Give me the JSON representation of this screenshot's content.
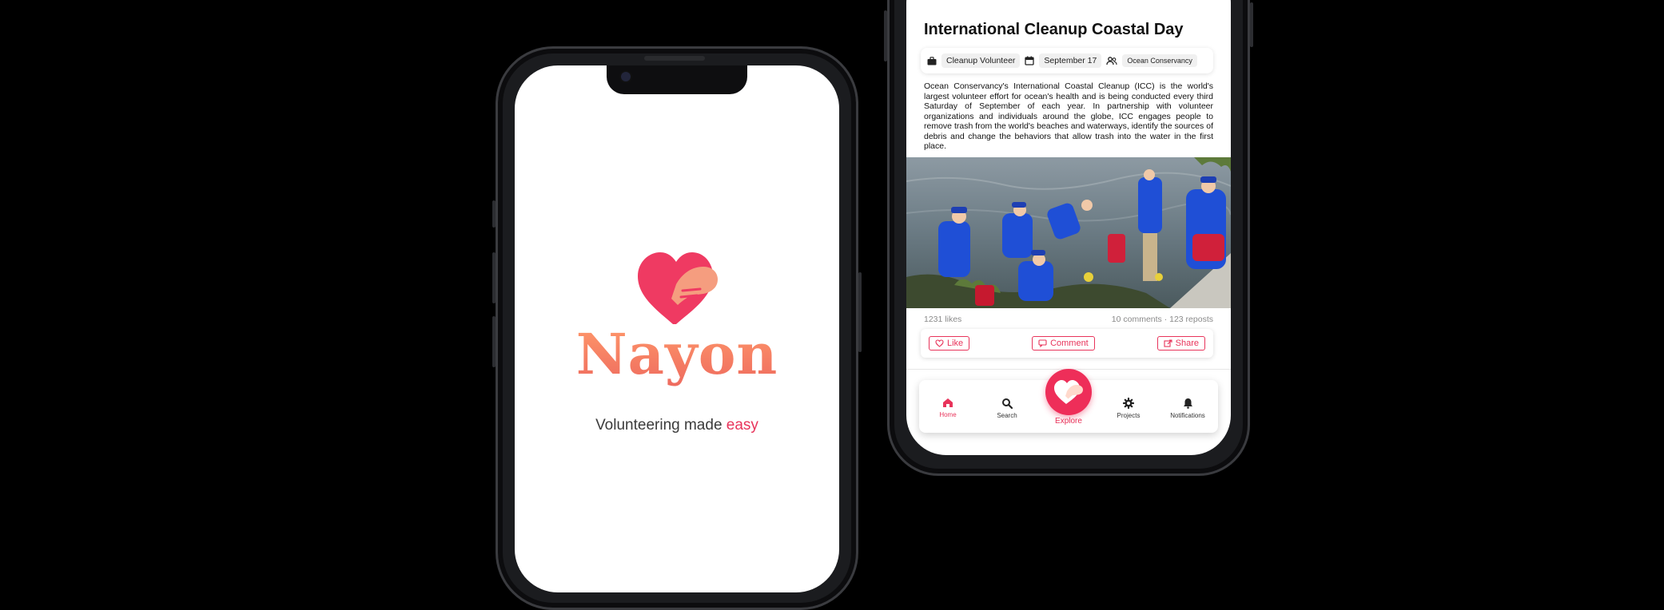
{
  "splash": {
    "brand": "Nayon",
    "tagline_main": "Volunteering made ",
    "tagline_accent": "easy",
    "colors": {
      "accent": "#e8345b",
      "heart": "#ef3a62",
      "hand": "#f59d7f"
    }
  },
  "post": {
    "title": "International Cleanup Coastal Day",
    "category": "Cleanup Volunteer",
    "date": "September 17",
    "organizer": "Ocean Conservancy",
    "description": "Ocean Conservancy's International Coastal Cleanup (ICC) is the world's largest volunteer effort for ocean's health and is being conducted every third Saturday of September of each year. In partnership with volunteer organizations and individuals around the globe, ICC engages people to remove trash from the world's beaches and waterways, identify the sources of debris and change the behaviors that allow trash into the water in the first place.",
    "likes": "1231 likes",
    "engagement": "10 comments · 123 reposts",
    "actions": {
      "like": "Like",
      "comment": "Comment",
      "share": "Share"
    },
    "icons": [
      "briefcase-icon",
      "calendar-icon",
      "people-icon"
    ]
  },
  "nav": {
    "home": "Home",
    "search": "Search",
    "explore": "Explore",
    "projects": "Projects",
    "notifications": "Notifications",
    "active": "home",
    "colors": {
      "active": "#e8345b",
      "explore_bg": "#ee2e59"
    }
  }
}
